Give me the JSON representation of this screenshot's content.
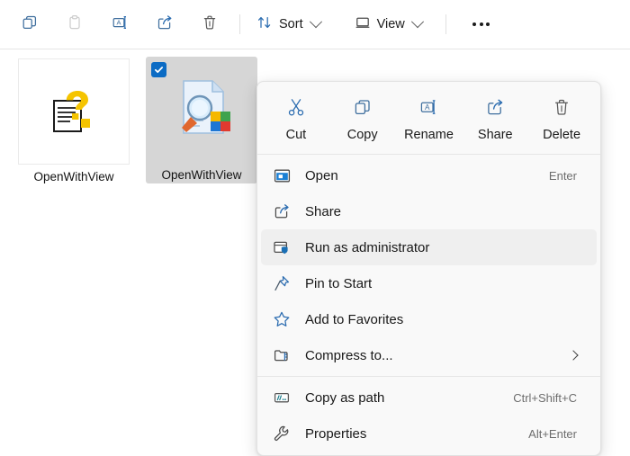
{
  "toolbar": {
    "buttons": [
      {
        "name": "copy",
        "icon": "copy-icon",
        "label": "",
        "disabled": false
      },
      {
        "name": "paste",
        "icon": "paste-icon",
        "label": "",
        "disabled": true
      },
      {
        "name": "rename",
        "icon": "rename-icon",
        "label": "",
        "disabled": false
      },
      {
        "name": "share",
        "icon": "share-icon",
        "label": "",
        "disabled": false
      },
      {
        "name": "delete",
        "icon": "delete-icon",
        "label": "",
        "disabled": false
      }
    ],
    "sort_label": "Sort",
    "view_label": "View",
    "more_label": "See more"
  },
  "files": [
    {
      "name": "OpenWithView",
      "icon": "help-document-icon",
      "selected": false
    },
    {
      "name": "OpenWithView",
      "icon": "openwithview-app-icon",
      "selected": true
    },
    {
      "name": "",
      "icon": "text-document-icon",
      "selected": false
    }
  ],
  "context_menu": {
    "icon_actions": [
      {
        "id": "cut",
        "label": "Cut",
        "icon": "scissors-icon"
      },
      {
        "id": "copy",
        "label": "Copy",
        "icon": "copy-icon"
      },
      {
        "id": "rename",
        "label": "Rename",
        "icon": "rename-icon"
      },
      {
        "id": "share",
        "label": "Share",
        "icon": "share-icon"
      },
      {
        "id": "delete",
        "label": "Delete",
        "icon": "trash-icon"
      }
    ],
    "items": [
      {
        "id": "open",
        "label": "Open",
        "shortcut": "Enter",
        "icon": "window-open-icon",
        "highlighted": false,
        "submenu": false
      },
      {
        "id": "share",
        "label": "Share",
        "shortcut": "",
        "icon": "share-icon",
        "highlighted": false,
        "submenu": false
      },
      {
        "id": "run-as-admin",
        "label": "Run as administrator",
        "shortcut": "",
        "icon": "shield-window-icon",
        "highlighted": true,
        "submenu": false
      },
      {
        "id": "pin-to-start",
        "label": "Pin to Start",
        "shortcut": "",
        "icon": "pin-icon",
        "highlighted": false,
        "submenu": false
      },
      {
        "id": "add-favorites",
        "label": "Add to Favorites",
        "shortcut": "",
        "icon": "star-icon",
        "highlighted": false,
        "submenu": false
      },
      {
        "id": "compress-to",
        "label": "Compress to...",
        "shortcut": "",
        "icon": "zip-folder-icon",
        "highlighted": false,
        "submenu": true
      },
      {
        "id": "copy-as-path",
        "label": "Copy as path",
        "shortcut": "Ctrl+Shift+C",
        "icon": "path-box-icon",
        "highlighted": false,
        "submenu": false
      },
      {
        "id": "properties",
        "label": "Properties",
        "shortcut": "Alt+Enter",
        "icon": "wrench-icon",
        "highlighted": false,
        "submenu": false
      }
    ]
  },
  "colors": {
    "accent": "#0b6bc4",
    "icon_blue": "#1a6fb5",
    "menu_bg": "#f9f9f9",
    "highlight": "#efefef",
    "selection_gray": "#d6d6d6"
  }
}
